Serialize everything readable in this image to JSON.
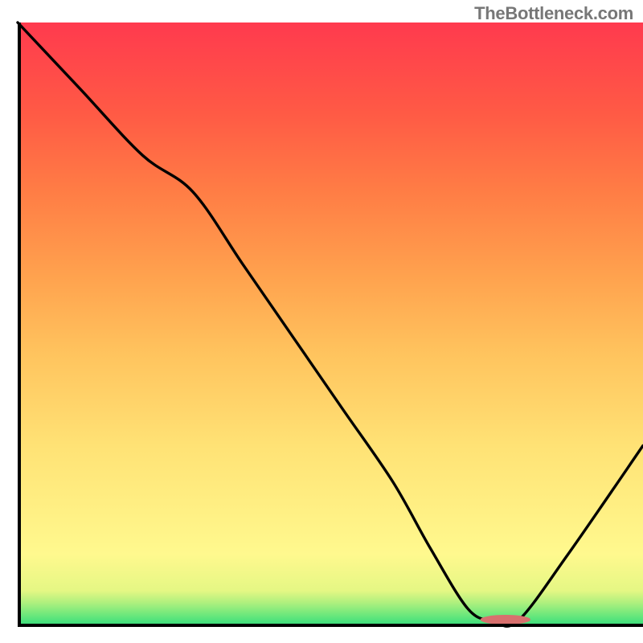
{
  "watermark": "TheBottleneck.com",
  "colors": {
    "axis": "#000000",
    "curve": "#000000",
    "marker": "#d8706e",
    "gradient_top": "#ff3a4e",
    "gradient_bottom": "#2fdc7b"
  },
  "chart_data": {
    "type": "line",
    "title": "",
    "xlabel": "",
    "ylabel": "",
    "xlim": [
      0,
      100
    ],
    "ylim": [
      0,
      100
    ],
    "grid": false,
    "legend": false,
    "series": [
      {
        "name": "bottleneck-curve",
        "x": [
          0,
          10,
          20,
          28,
          36,
          44,
          52,
          60,
          66,
          72,
          76,
          80,
          88,
          100
        ],
        "y": [
          100,
          89,
          78,
          72,
          60,
          48,
          36,
          24,
          13,
          3,
          1,
          1,
          12,
          30
        ]
      }
    ],
    "annotations": [
      {
        "name": "optimal-region-marker",
        "shape": "rounded-rect",
        "x_range": [
          74,
          82
        ],
        "y": 1.2
      }
    ],
    "background": {
      "type": "vertical-gradient-green-yellow-red",
      "meaning": "lower y = better (green), higher y = worse (red)"
    }
  }
}
